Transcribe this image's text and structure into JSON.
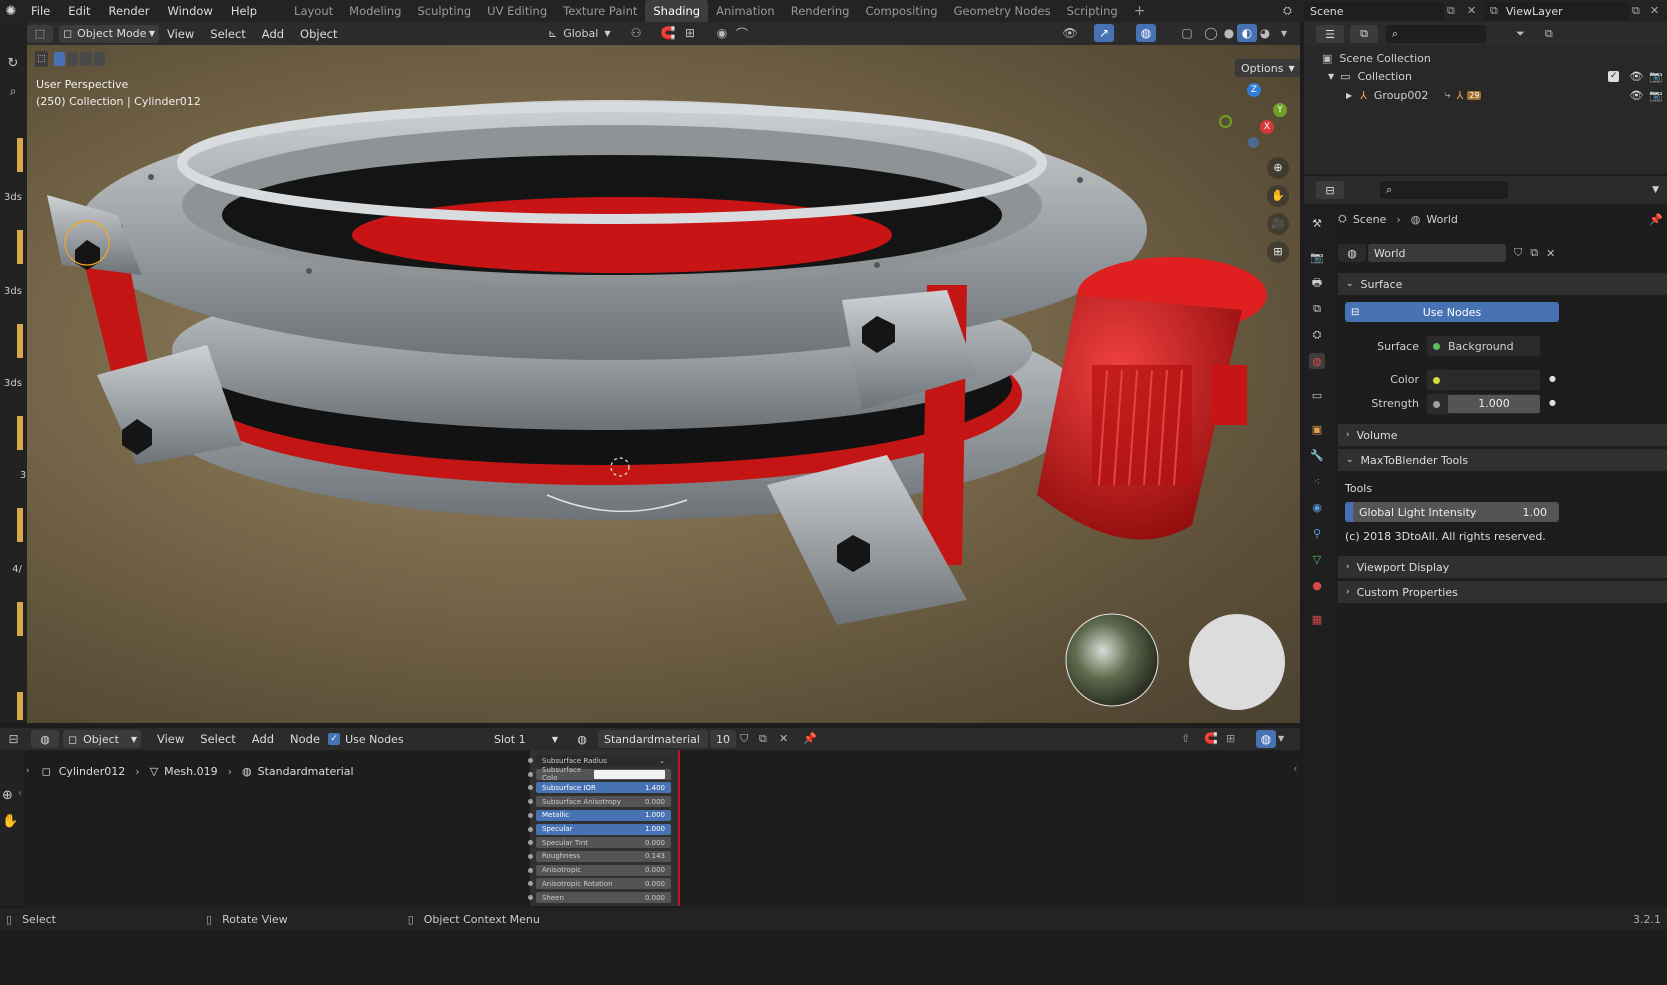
{
  "topbar": {
    "menus": [
      "File",
      "Edit",
      "Render",
      "Window",
      "Help"
    ],
    "workspaces": [
      "Layout",
      "Modeling",
      "Sculpting",
      "UV Editing",
      "Texture Paint",
      "Shading",
      "Animation",
      "Rendering",
      "Compositing",
      "Geometry Nodes",
      "Scripting"
    ],
    "active_workspace": "Shading",
    "add_tab": "+",
    "scene": "Scene",
    "view_layer": "ViewLayer"
  },
  "viewport_header": {
    "mode": "Object Mode",
    "menus": [
      "View",
      "Select",
      "Add",
      "Object"
    ],
    "transform_orientation": "Global",
    "options": "Options"
  },
  "viewport": {
    "perspective": "User Perspective",
    "context": "(250) Collection | Cylinder012",
    "axes": {
      "x": "X",
      "y": "Y",
      "z": "Z"
    }
  },
  "left_toolbar_labels": [
    "3ds",
    "3ds",
    "3ds",
    "3",
    "4/"
  ],
  "outliner": {
    "scene_collection": "Scene Collection",
    "collection": "Collection",
    "group": "Group002",
    "group_badge": "29"
  },
  "properties": {
    "breadcrumb_scene": "Scene",
    "breadcrumb_world": "World",
    "world_name": "World",
    "surface_section": "Surface",
    "use_nodes": "Use Nodes",
    "surface_label": "Surface",
    "surface_value": "Background",
    "color_label": "Color",
    "strength_label": "Strength",
    "strength_value": "1.000",
    "volume_section": "Volume",
    "maxtoblender_section": "MaxToBlender Tools",
    "tools_label": "Tools",
    "global_light_label": "Global Light Intensity",
    "global_light_value": "1.00",
    "copyright": "(c) 2018 3DtoAll. All rights reserved.",
    "viewport_display_section": "Viewport Display",
    "custom_props_section": "Custom Properties"
  },
  "node_header": {
    "mode": "Object",
    "menus": [
      "View",
      "Select",
      "Add",
      "Node"
    ],
    "use_nodes": "Use Nodes",
    "slot": "Slot 1",
    "material": "Standardmaterial",
    "users": "10"
  },
  "node_breadcrumb": {
    "object": "Cylinder012",
    "mesh": "Mesh.019",
    "material": "Standardmaterial"
  },
  "node_rows": [
    {
      "label": "Subsurface Radius",
      "value": "",
      "style": "dropdown"
    },
    {
      "label": "Subsurface Colo",
      "value": "",
      "style": "color"
    },
    {
      "label": "Subsurface IOR",
      "value": "1.400",
      "style": "blue"
    },
    {
      "label": "Subsurface Anisotropy",
      "value": "0.000",
      "style": "grey"
    },
    {
      "label": "Metallic",
      "value": "1.000",
      "style": "blue"
    },
    {
      "label": "Specular",
      "value": "1.000",
      "style": "blue"
    },
    {
      "label": "Specular Tint",
      "value": "0.000",
      "style": "grey"
    },
    {
      "label": "Roughness",
      "value": "0.143",
      "style": "grey"
    },
    {
      "label": "Anisotropic",
      "value": "0.000",
      "style": "grey"
    },
    {
      "label": "Anisotropic Rotation",
      "value": "0.000",
      "style": "grey"
    },
    {
      "label": "Sheen",
      "value": "0.000",
      "style": "grey"
    }
  ],
  "status_bar": {
    "select": "Select",
    "rotate": "Rotate View",
    "context_menu": "Object Context Menu",
    "version": "3.2.1"
  },
  "colors": {
    "accent_blue": "#4772b3",
    "active_orange": "#f5a623",
    "object_red": "#c81414",
    "metal": "#b9bcbf"
  }
}
